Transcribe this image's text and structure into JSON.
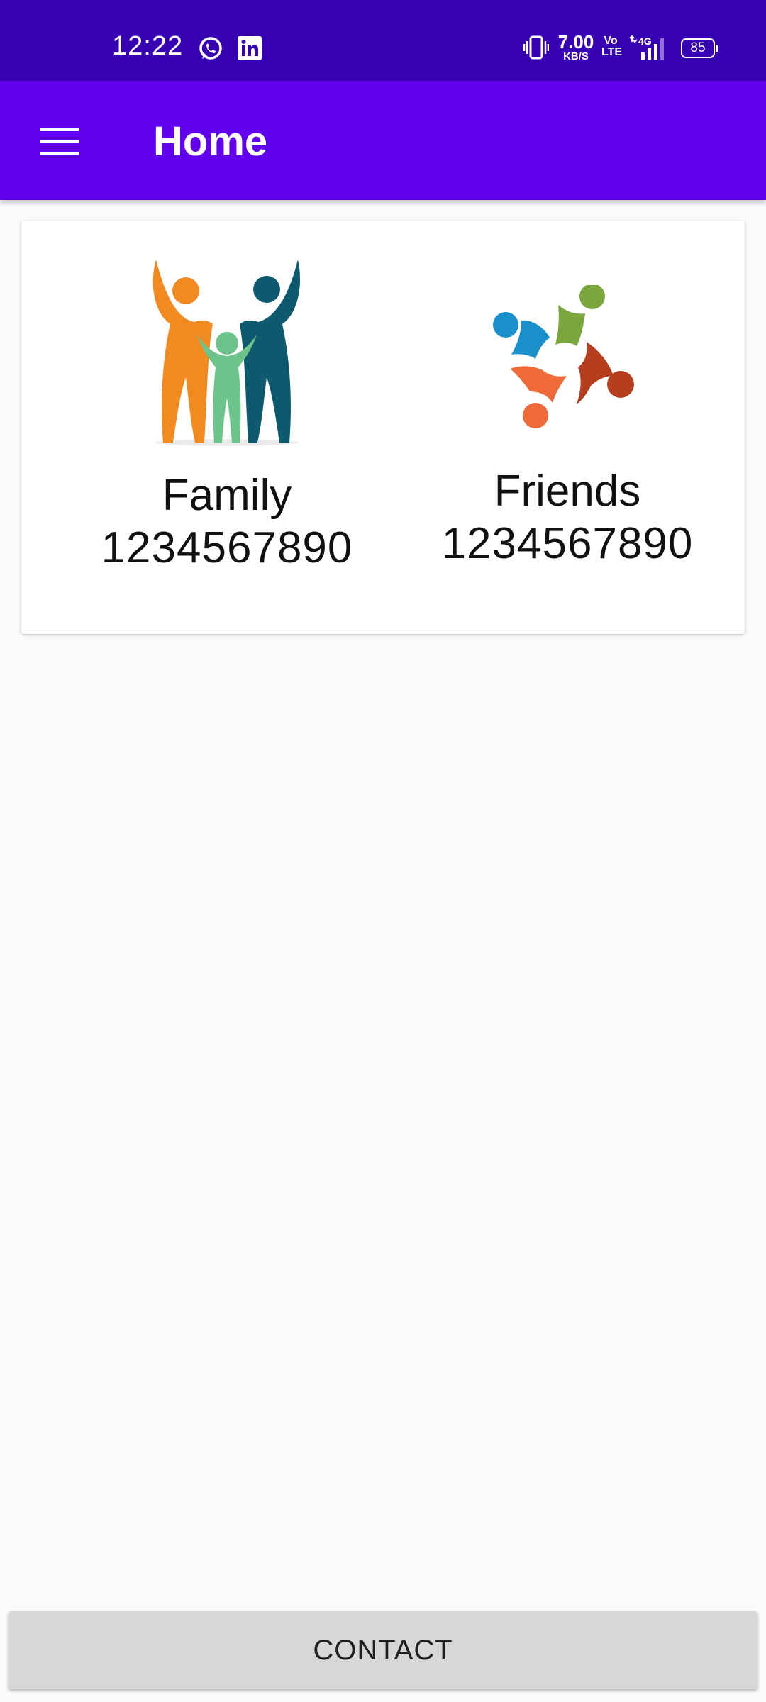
{
  "status_bar": {
    "time": "12:22",
    "notification_icons": [
      "whatsapp-icon",
      "linkedin-icon"
    ],
    "net_speed_value": "7.00",
    "net_speed_unit": "KB/S",
    "volte": "Vo\nLTE",
    "network": "4G",
    "battery": "85"
  },
  "app_bar": {
    "menu_icon": "hamburger-menu-icon",
    "title": "Home"
  },
  "groups": [
    {
      "name": "Family",
      "number": "1234567890",
      "icon": "family-people-icon"
    },
    {
      "name": "Friends",
      "number": "1234567890",
      "icon": "friends-circle-icon"
    }
  ],
  "contact_button": {
    "label": "CONTACT"
  },
  "colors": {
    "status_bar": "#3700b3",
    "app_bar": "#6200ee",
    "background": "#fafafa",
    "button": "#d6d7d7"
  }
}
